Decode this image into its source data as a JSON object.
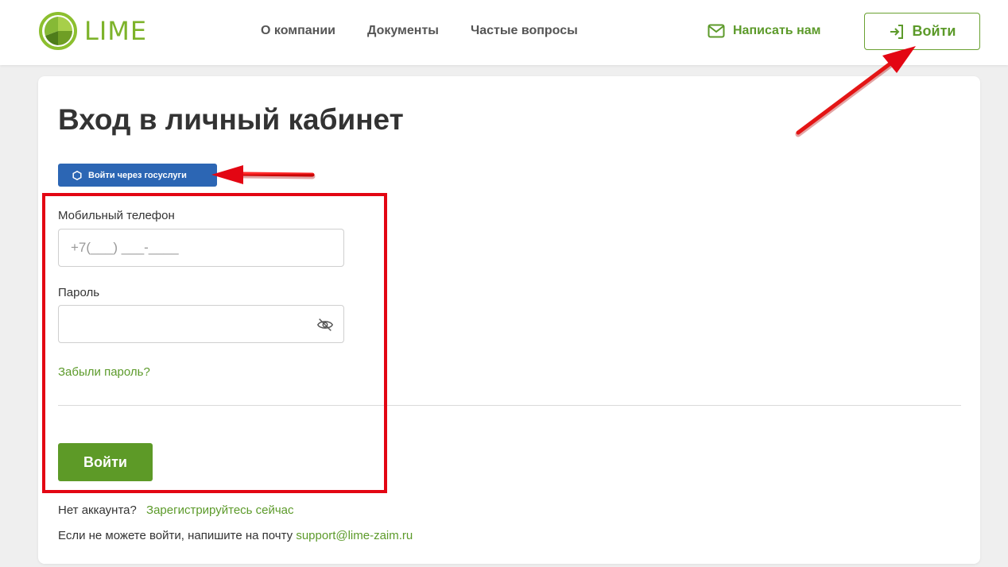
{
  "header": {
    "logo_text": "LIME",
    "nav": [
      {
        "label": "О компании"
      },
      {
        "label": "Документы"
      },
      {
        "label": "Частые вопросы"
      }
    ],
    "write_us_label": "Написать нам",
    "login_label": "Войти"
  },
  "main": {
    "title": "Вход в личный кабинет",
    "gosuslugi_label": "Войти через госуслуги",
    "phone_label": "Мобильный телефон",
    "phone_placeholder": "+7(___) ___-____",
    "password_label": "Пароль",
    "password_value": "",
    "forgot_label": "Забыли пароль?",
    "submit_label": "Войти",
    "no_account_text": "Нет аккаунта?",
    "register_link": "Зарегистрируйтесь сейчас",
    "contact_text": "Если не можете войти, напишите на почту",
    "support_email": "support@lime-zaim.ru"
  },
  "colors": {
    "brand_green": "#5c9a2a",
    "gosuslugi_blue": "#2c66b4",
    "annotation_red": "#e30613"
  },
  "icons": [
    "lime-logo-icon",
    "envelope-icon",
    "login-arrow-icon",
    "gosuslugi-icon",
    "eye-off-icon"
  ]
}
